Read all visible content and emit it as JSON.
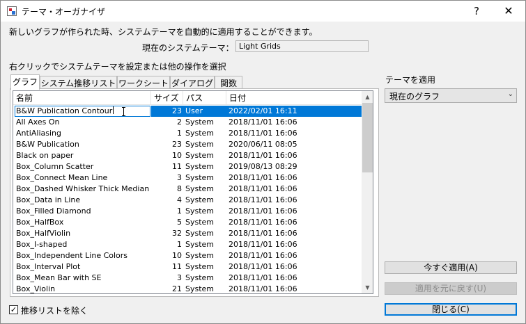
{
  "window": {
    "title": "テーマ・オーガナイザ",
    "help_label": "?",
    "close_label": "✕"
  },
  "intro_text": "新しいグラフが作られた時、システムテーマを自動的に適用することができます。",
  "current_theme": {
    "label": "現在のシステムテーマ：",
    "value": "Light Grids"
  },
  "right_click_hint": "右クリックでシステムテーマを設定または他の操作を選択",
  "tabs": [
    {
      "label": "グラフ",
      "active": true
    },
    {
      "label": "システム推移リスト"
    },
    {
      "label": "ワークシート"
    },
    {
      "label": "ダイアログ"
    },
    {
      "label": "関数"
    }
  ],
  "list": {
    "columns": {
      "name": "名前",
      "size": "サイズ",
      "path": "パス",
      "date": "日付"
    },
    "rows": [
      {
        "name": "B&W Publication Contour",
        "size": "23",
        "path": "User",
        "date": "2022/02/01 16:11",
        "selected": true
      },
      {
        "name": "All Axes On",
        "size": "2",
        "path": "System",
        "date": "2018/11/01 16:06"
      },
      {
        "name": "AntiAliasing",
        "size": "1",
        "path": "System",
        "date": "2018/11/01 16:06"
      },
      {
        "name": "B&W Publication",
        "size": "23",
        "path": "System",
        "date": "2020/06/11 08:05"
      },
      {
        "name": "Black on paper",
        "size": "10",
        "path": "System",
        "date": "2018/11/01 16:06"
      },
      {
        "name": "Box_Column Scatter",
        "size": "11",
        "path": "System",
        "date": "2019/08/13 08:29"
      },
      {
        "name": "Box_Connect Mean Line",
        "size": "3",
        "path": "System",
        "date": "2018/11/01 16:06"
      },
      {
        "name": "Box_Dashed Whisker Thick Median",
        "size": "8",
        "path": "System",
        "date": "2018/11/01 16:06"
      },
      {
        "name": "Box_Data in Line",
        "size": "4",
        "path": "System",
        "date": "2018/11/01 16:06"
      },
      {
        "name": "Box_Filled Diamond",
        "size": "1",
        "path": "System",
        "date": "2018/11/01 16:06"
      },
      {
        "name": "Box_HalfBox",
        "size": "5",
        "path": "System",
        "date": "2018/11/01 16:06"
      },
      {
        "name": "Box_HalfViolin",
        "size": "32",
        "path": "System",
        "date": "2018/11/01 16:06"
      },
      {
        "name": "Box_I-shaped",
        "size": "1",
        "path": "System",
        "date": "2018/11/01 16:06"
      },
      {
        "name": "Box_Independent Line Colors",
        "size": "10",
        "path": "System",
        "date": "2018/11/01 16:06"
      },
      {
        "name": "Box_Interval Plot",
        "size": "11",
        "path": "System",
        "date": "2018/11/01 16:06"
      },
      {
        "name": "Box_Mean Bar with SE",
        "size": "3",
        "path": "System",
        "date": "2018/11/01 16:06"
      },
      {
        "name": "Box_Violin",
        "size": "21",
        "path": "System",
        "date": "2018/11/01 16:06"
      }
    ]
  },
  "apply_theme": {
    "label": "テーマを適用",
    "selected": "現在のグラフ"
  },
  "buttons": {
    "apply_now": "今すぐ適用(A)",
    "undo_apply": "適用を元に戻す(U)",
    "close": "閉じる(C)"
  },
  "exclude_checkbox": {
    "label": "推移リストを除く",
    "checked": true,
    "mark": "✓"
  },
  "icons": {
    "scroll_up": "▲",
    "scroll_down": "▼",
    "dropdown": "⌄"
  },
  "colors": {
    "selection": "#0078d7"
  }
}
